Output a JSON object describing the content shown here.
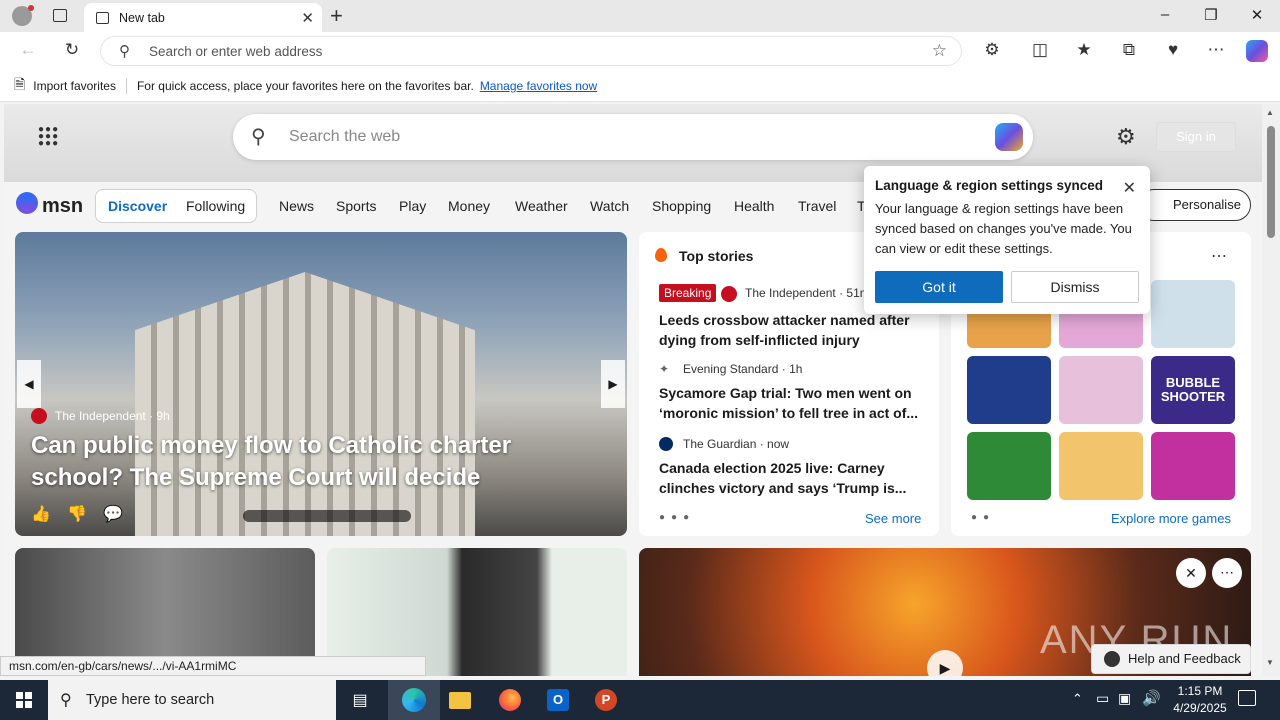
{
  "browser": {
    "tab_title": "New tab",
    "address_placeholder": "Search or enter web address",
    "favorites": {
      "import_label": "Import favorites",
      "hint": "For quick access, place your favorites here on the favorites bar.",
      "manage_link": "Manage favorites now"
    },
    "status_url": "msn.com/en-gb/cars/news/.../vi-AA1rmiMC"
  },
  "page": {
    "search_placeholder": "Search the web",
    "sign_in": "Sign in",
    "logo": "msn",
    "nav_toggle": [
      "Discover",
      "Following"
    ],
    "nav_items": [
      "News",
      "Sports",
      "Play",
      "Money",
      "Weather",
      "Watch",
      "Shopping",
      "Health",
      "Travel",
      "T"
    ],
    "personalise": "Personalise"
  },
  "hero": {
    "source": "The Independent",
    "age": "9h",
    "headline": "Can public money flow to Catholic charter school? The Supreme Court will decide"
  },
  "top_stories": {
    "title": "Top stories",
    "items": [
      {
        "badge": "Breaking",
        "source": "The Independent · 51m",
        "headline": "Leeds crossbow attacker named after dying from self-inflicted injury"
      },
      {
        "source": "Evening Standard · 1h",
        "headline": "Sycamore Gap trial: Two men went on ‘moronic mission’ to fell tree in act of..."
      },
      {
        "source": "The Guardian · now",
        "headline": "Canada election 2025 live: Carney clinches victory and says ‘Trump is..."
      }
    ],
    "see_more": "See more"
  },
  "games": {
    "explore": "Explore more games",
    "bubble_text": "BUBBLE SHOOTER"
  },
  "popup": {
    "title": "Language & region settings synced",
    "body": "Your language & region settings have been synced based on changes you've made. You can view or edit these settings.",
    "got_it": "Got it",
    "dismiss": "Dismiss"
  },
  "feedback": "Help and Feedback",
  "watermark": "ANY RUN",
  "taskbar": {
    "search_placeholder": "Type here to search",
    "time": "1:15 PM",
    "date": "4/29/2025"
  },
  "colors": {
    "accent": "#0f6cbd",
    "breaking": "#c50f1f",
    "taskbar": "#1c2838"
  }
}
